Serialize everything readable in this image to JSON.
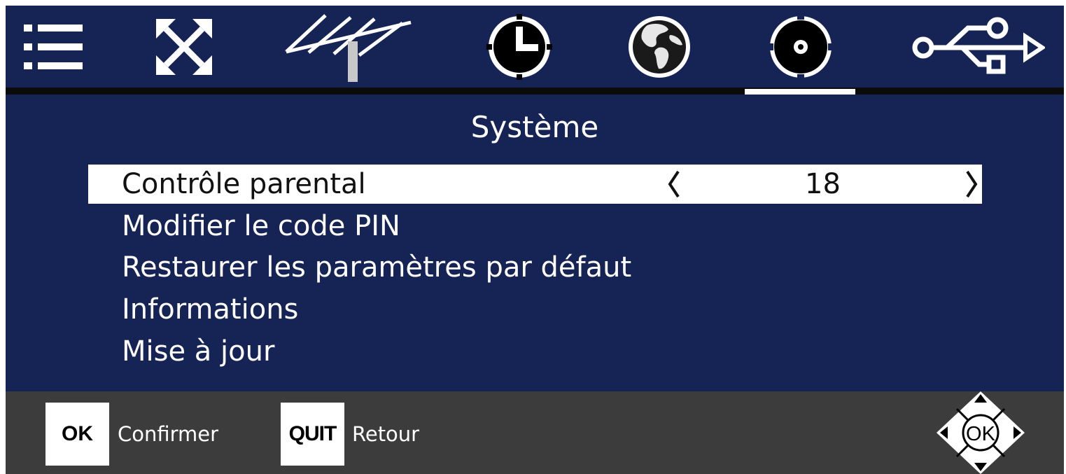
{
  "tabs": [
    {
      "icon": "menu-list-icon"
    },
    {
      "icon": "resize-arrows-icon"
    },
    {
      "icon": "antenna-icon"
    },
    {
      "icon": "clock-icon"
    },
    {
      "icon": "globe-icon"
    },
    {
      "icon": "gear-icon",
      "active": true
    },
    {
      "icon": "usb-icon"
    }
  ],
  "page_title": "Système",
  "menu": [
    {
      "label": "Contrôle parental",
      "value": "18",
      "selected": true
    },
    {
      "label": "Modifier le code PIN"
    },
    {
      "label": "Restaurer les paramètres par défaut"
    },
    {
      "label": "Informations"
    },
    {
      "label": "Mise à jour"
    }
  ],
  "footer": {
    "ok_key": "OK",
    "ok_label": "Confirmer",
    "quit_key": "QUIT",
    "quit_label": "Retour",
    "dpad_center": "OK",
    "dpad_icon": "navigation-pad-icon"
  },
  "colors": {
    "background": "#162455",
    "footer": "#3c3c3c",
    "highlight": "#ffffff",
    "separator": "#0b0b0b"
  }
}
